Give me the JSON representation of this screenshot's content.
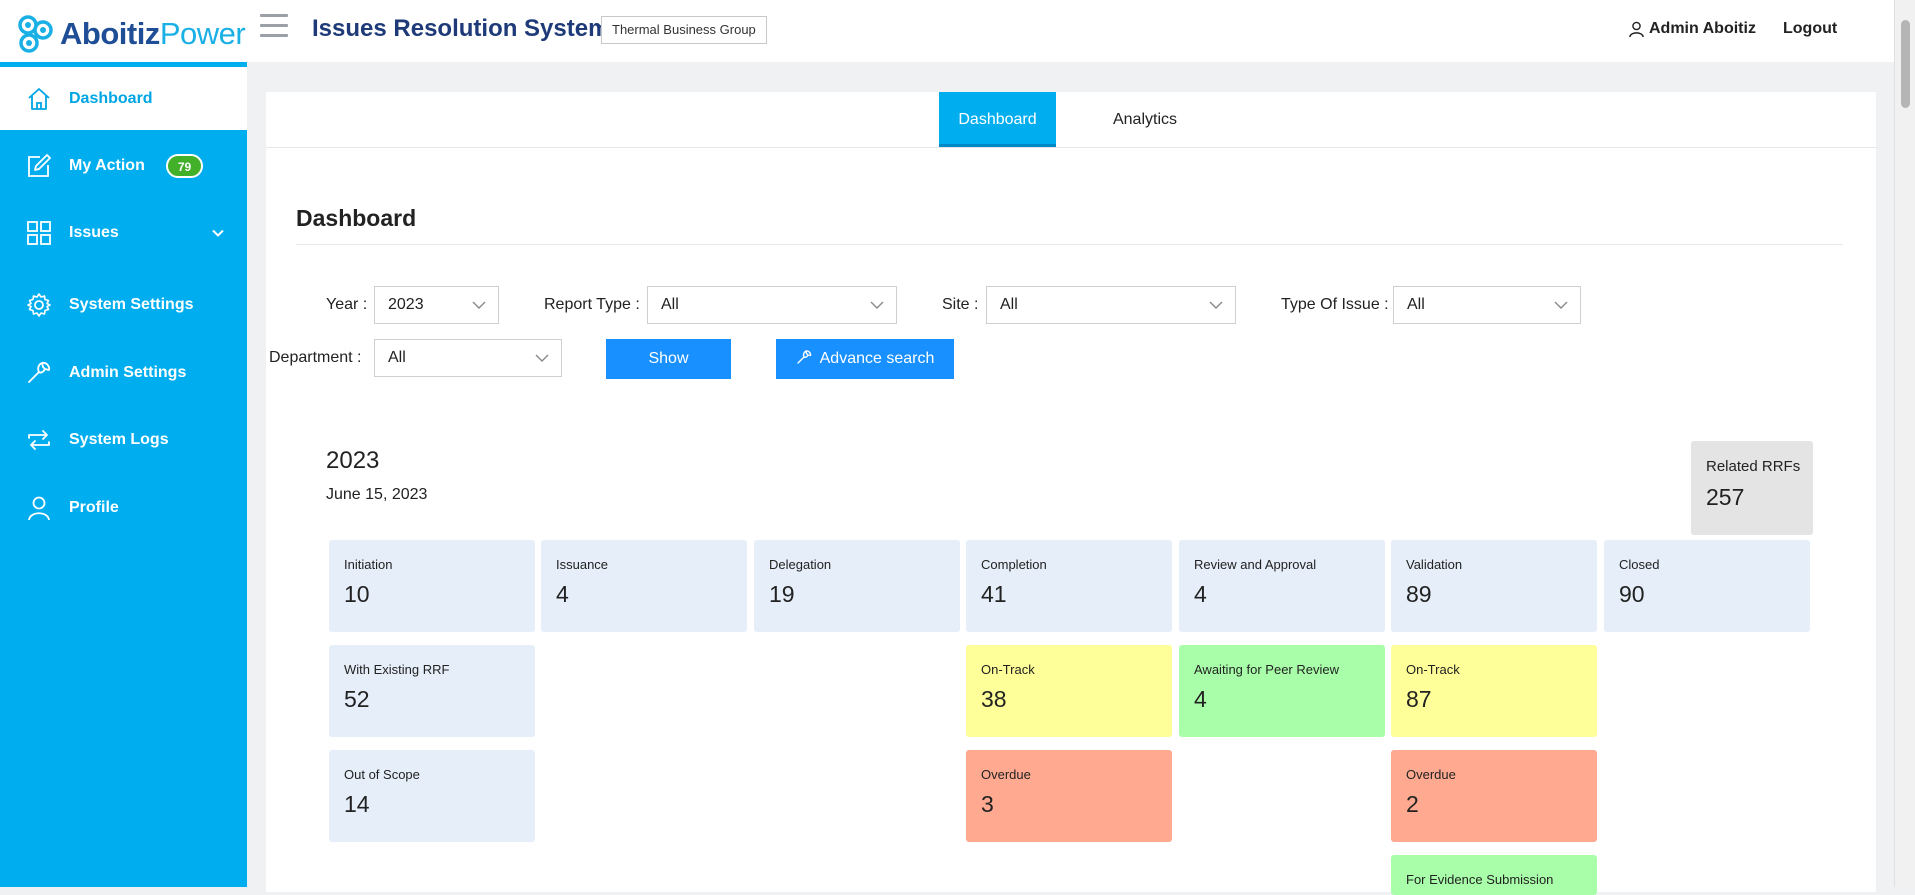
{
  "header": {
    "logo_part1": "Aboitiz",
    "logo_part2": "Power",
    "app_title": "Issues Resolution System",
    "business_group": "Thermal Business Group",
    "user_name": "Admin Aboitiz",
    "logout_label": "Logout"
  },
  "sidebar": {
    "items": [
      {
        "label": "Dashboard",
        "icon": "home-icon"
      },
      {
        "label": "My Action",
        "icon": "edit-icon",
        "badge": "79"
      },
      {
        "label": "Issues",
        "icon": "grid-icon"
      },
      {
        "label": "System Settings",
        "icon": "gear-icon"
      },
      {
        "label": "Admin Settings",
        "icon": "wrench-icon"
      },
      {
        "label": "System Logs",
        "icon": "refresh-icon"
      },
      {
        "label": "Profile",
        "icon": "user-icon"
      }
    ]
  },
  "tabs": {
    "dashboard": "Dashboard",
    "analytics": "Analytics"
  },
  "page_title": "Dashboard",
  "filters": {
    "year_label": "Year :",
    "year_value": "2023",
    "report_type_label": "Report Type :",
    "report_type_value": "All",
    "site_label": "Site :",
    "site_value": "All",
    "type_issue_label": "Type Of Issue :",
    "type_issue_value": "All",
    "department_label": "Department :",
    "department_value": "All",
    "show_button": "Show",
    "advance_button": "Advance search"
  },
  "summary": {
    "year": "2023",
    "date": "June 15, 2023",
    "related_label": "Related RRFs",
    "related_value": "257"
  },
  "stages": [
    {
      "label": "Initiation",
      "value": "10"
    },
    {
      "label": "Issuance",
      "value": "4"
    },
    {
      "label": "Delegation",
      "value": "19"
    },
    {
      "label": "Completion",
      "value": "41"
    },
    {
      "label": "Review and Approval",
      "value": "4"
    },
    {
      "label": "Validation",
      "value": "89"
    },
    {
      "label": "Closed",
      "value": "90"
    }
  ],
  "substats": {
    "with_existing_rrf": {
      "label": "With Existing RRF",
      "value": "52"
    },
    "out_of_scope": {
      "label": "Out of Scope",
      "value": "14"
    },
    "completion_on_track": {
      "label": "On-Track",
      "value": "38"
    },
    "completion_overdue": {
      "label": "Overdue",
      "value": "3"
    },
    "awaiting_peer_review": {
      "label": "Awaiting for Peer Review",
      "value": "4"
    },
    "validation_on_track": {
      "label": "On-Track",
      "value": "87"
    },
    "validation_overdue": {
      "label": "Overdue",
      "value": "2"
    },
    "for_evidence": {
      "label": "For Evidence Submission"
    }
  },
  "colors": {
    "sidebar": "#00aeef",
    "primary_button": "#1890ff",
    "card_default": "#e5eef9",
    "card_on_track": "#ffff99",
    "card_peer_review": "#a9ffa9",
    "card_overdue": "#ffaa90",
    "badge": "#43b02a"
  }
}
